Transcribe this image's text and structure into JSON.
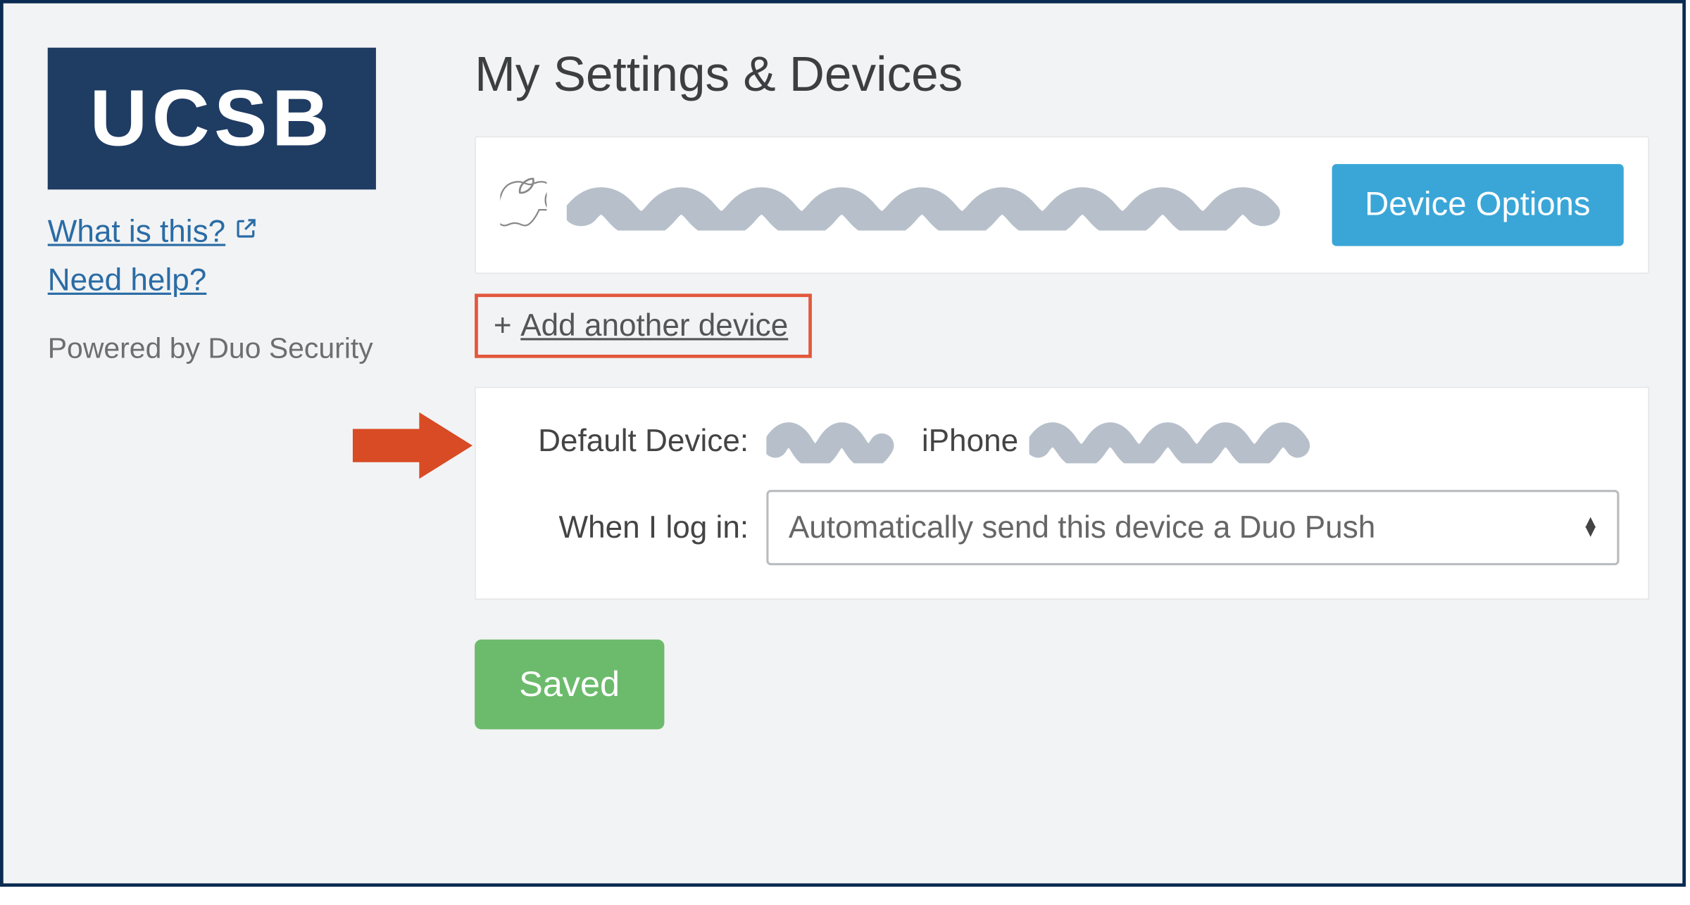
{
  "sidebar": {
    "logo_text": "UCSB",
    "links": {
      "what_is_this": "What is this?",
      "need_help": "Need help?"
    },
    "powered_by": "Powered by Duo Security"
  },
  "main": {
    "title": "My Settings & Devices",
    "device_card": {
      "device_options_label": "Device Options"
    },
    "add_device": {
      "plus": "+",
      "label": "Add another device"
    },
    "settings": {
      "default_device_label": "Default Device:",
      "default_device_value_middle": "iPhone",
      "when_i_log_in_label": "When I log in:",
      "when_i_log_in_value": "Automatically send this device a Duo Push"
    },
    "saved_button": "Saved"
  }
}
